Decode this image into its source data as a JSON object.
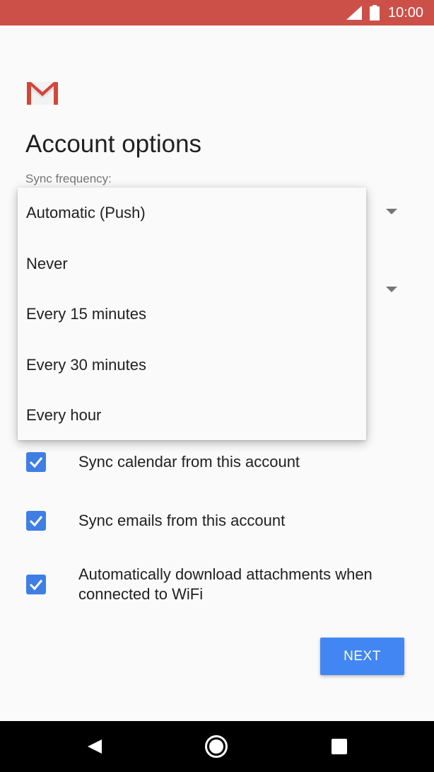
{
  "status_bar": {
    "time": "10:00",
    "icons": [
      "signal-icon",
      "battery-icon"
    ]
  },
  "header": {
    "logo": "gmail-logo",
    "title": "Account options"
  },
  "form": {
    "sync_frequency_label": "Sync frequency:"
  },
  "menu": {
    "items": [
      "Automatic (Push)",
      "Never",
      "Every 15 minutes",
      "Every 30 minutes",
      "Every hour"
    ]
  },
  "checkboxes": [
    {
      "label": "Sync calendar from this account",
      "checked": true
    },
    {
      "label": "Sync emails from this account",
      "checked": true
    },
    {
      "label": "Automatically download attachments when connected to WiFi",
      "checked": true
    }
  ],
  "actions": {
    "next_label": "NEXT"
  },
  "colors": {
    "status_bar": "#cc5048",
    "accent": "#4286f4",
    "checkbox": "#3f7fe5"
  },
  "nav_bar": {
    "icons": [
      "back-icon",
      "home-icon",
      "recents-icon"
    ]
  }
}
